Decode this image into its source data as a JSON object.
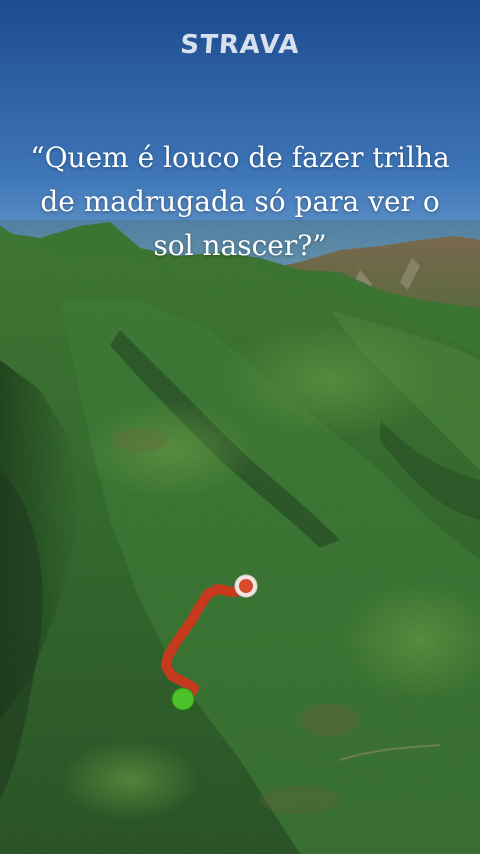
{
  "brand": {
    "name": "STRAVA"
  },
  "headline": {
    "quote": "“Quem é louco de fazer trilha de madrugada só para ver o sol nascer?”"
  },
  "map": {
    "route_color": "#c53a1d",
    "start_marker_color": "#4cc12a",
    "end_marker_color": "#d74b2a",
    "sky_top_color": "#1f4f93",
    "sky_bottom_color": "#7fb0d9"
  }
}
